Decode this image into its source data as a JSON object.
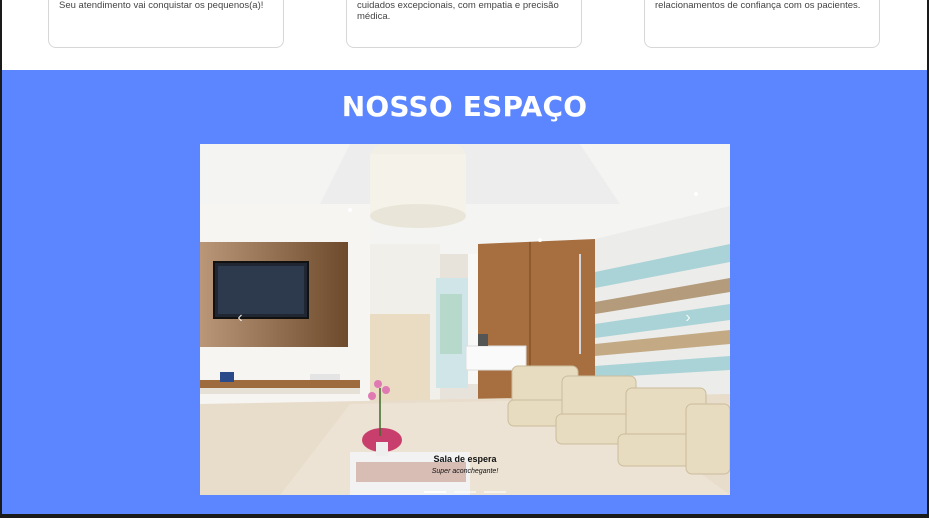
{
  "cards": [
    {
      "text": "Seu atendimento vai conquistar os pequenos(a)!"
    },
    {
      "text": "cuidados excepcionais, com empatia e precisão médica."
    },
    {
      "text": "relacionamentos de confiança com os pacientes."
    }
  ],
  "section": {
    "title": "NOSSO ESPAÇO"
  },
  "carousel": {
    "prev_icon": "chevron-left-icon",
    "next_icon": "chevron-right-icon",
    "prev_glyph": "‹",
    "next_glyph": "›",
    "caption_title": "Sala de espera",
    "caption_subtitle": "Super aconchegante!",
    "slide_count": 3,
    "active_slide": 1
  },
  "colors": {
    "section_bg": "#5b86ff",
    "title": "#ffffff"
  }
}
